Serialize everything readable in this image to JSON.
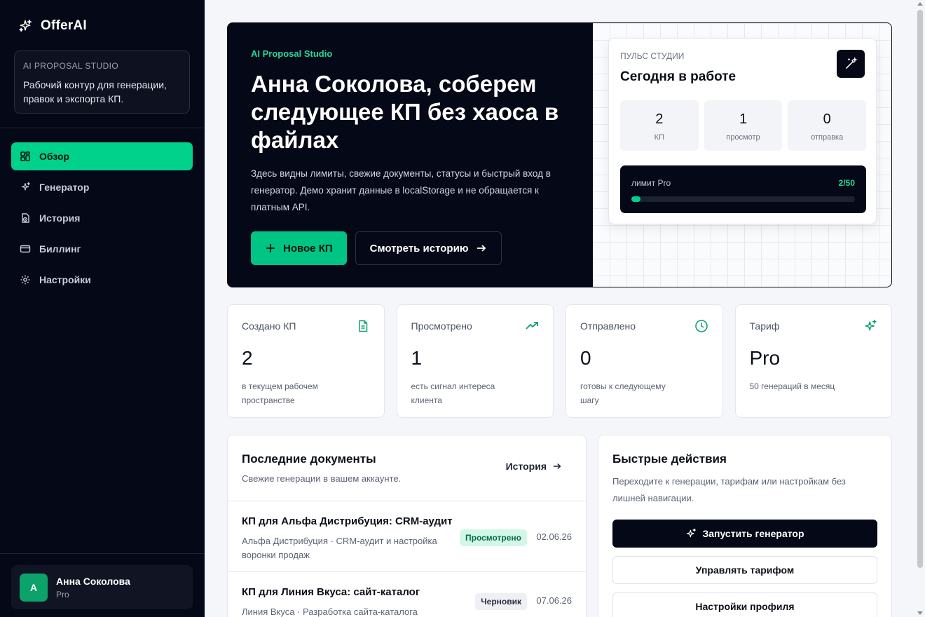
{
  "app": {
    "name": "OfferAI"
  },
  "sidebar": {
    "studio_card": {
      "eyebrow": "AI PROPOSAL STUDIO",
      "description": "Рабочий контур для генерации, правок и экспорта КП."
    },
    "nav": [
      {
        "label": "Обзор",
        "icon": "dashboard-icon",
        "active": true
      },
      {
        "label": "Генератор",
        "icon": "sparkles-icon",
        "active": false
      },
      {
        "label": "История",
        "icon": "history-icon",
        "active": false
      },
      {
        "label": "Биллинг",
        "icon": "card-icon",
        "active": false
      },
      {
        "label": "Настройки",
        "icon": "gear-icon",
        "active": false
      }
    ],
    "user": {
      "initial": "А",
      "name": "Анна Соколова",
      "plan": "Pro"
    }
  },
  "hero": {
    "eyebrow": "AI Proposal Studio",
    "title": "Анна Соколова, соберем следующее КП без хаоса в файлах",
    "description": "Здесь видны лимиты, свежие документы, статусы и быстрый вход в генератор. Демо хранит данные в localStorage и не обращается к платным API.",
    "primary_button": "Новое КП",
    "secondary_button": "Смотреть историю"
  },
  "pulse": {
    "eyebrow": "ПУЛЬС СТУДИИ",
    "title": "Сегодня в работе",
    "stats": [
      {
        "value": "2",
        "label": "КП"
      },
      {
        "value": "1",
        "label": "просмотр"
      },
      {
        "value": "0",
        "label": "отправка"
      }
    ],
    "limit_label": "лимит Pro",
    "limit_value": "2/50",
    "limit_fraction": 0.04
  },
  "stats": [
    {
      "label": "Создано КП",
      "value": "2",
      "sub": "в текущем рабочем пространстве",
      "icon": "file-icon"
    },
    {
      "label": "Просмотрено",
      "value": "1",
      "sub": "есть сигнал интереса клиента",
      "icon": "trending-up-icon"
    },
    {
      "label": "Отправлено",
      "value": "0",
      "sub": "готовы к следующему шагу",
      "icon": "clock-icon"
    },
    {
      "label": "Тариф",
      "value": "Pro",
      "sub": "50 генераций в месяц",
      "icon": "sparkles-icon"
    }
  ],
  "docs": {
    "title": "Последние документы",
    "subtitle": "Свежие генерации в вашем аккаунте.",
    "link": "История",
    "rows": [
      {
        "title": "КП для Альфа Дистрибуция: CRM-аудит",
        "meta": "Альфа Дистрибуция · CRM-аудит и настройка воронки продаж",
        "status": "Просмотрено",
        "date": "02.06.26"
      },
      {
        "title": "КП для Линия Вкуса: сайт-каталог",
        "meta": "Линия Вкуса · Разработка сайта-каталога",
        "status": "Черновик",
        "date": "07.06.26"
      }
    ]
  },
  "quick": {
    "title": "Быстрые действия",
    "description": "Переходите к генерации, тарифам или настройкам без лишней навигации.",
    "buttons": [
      "Запустить генератор",
      "Управлять тарифом",
      "Настройки профиля"
    ]
  },
  "colors": {
    "accent": "#00d18b",
    "dark": "#050816"
  }
}
